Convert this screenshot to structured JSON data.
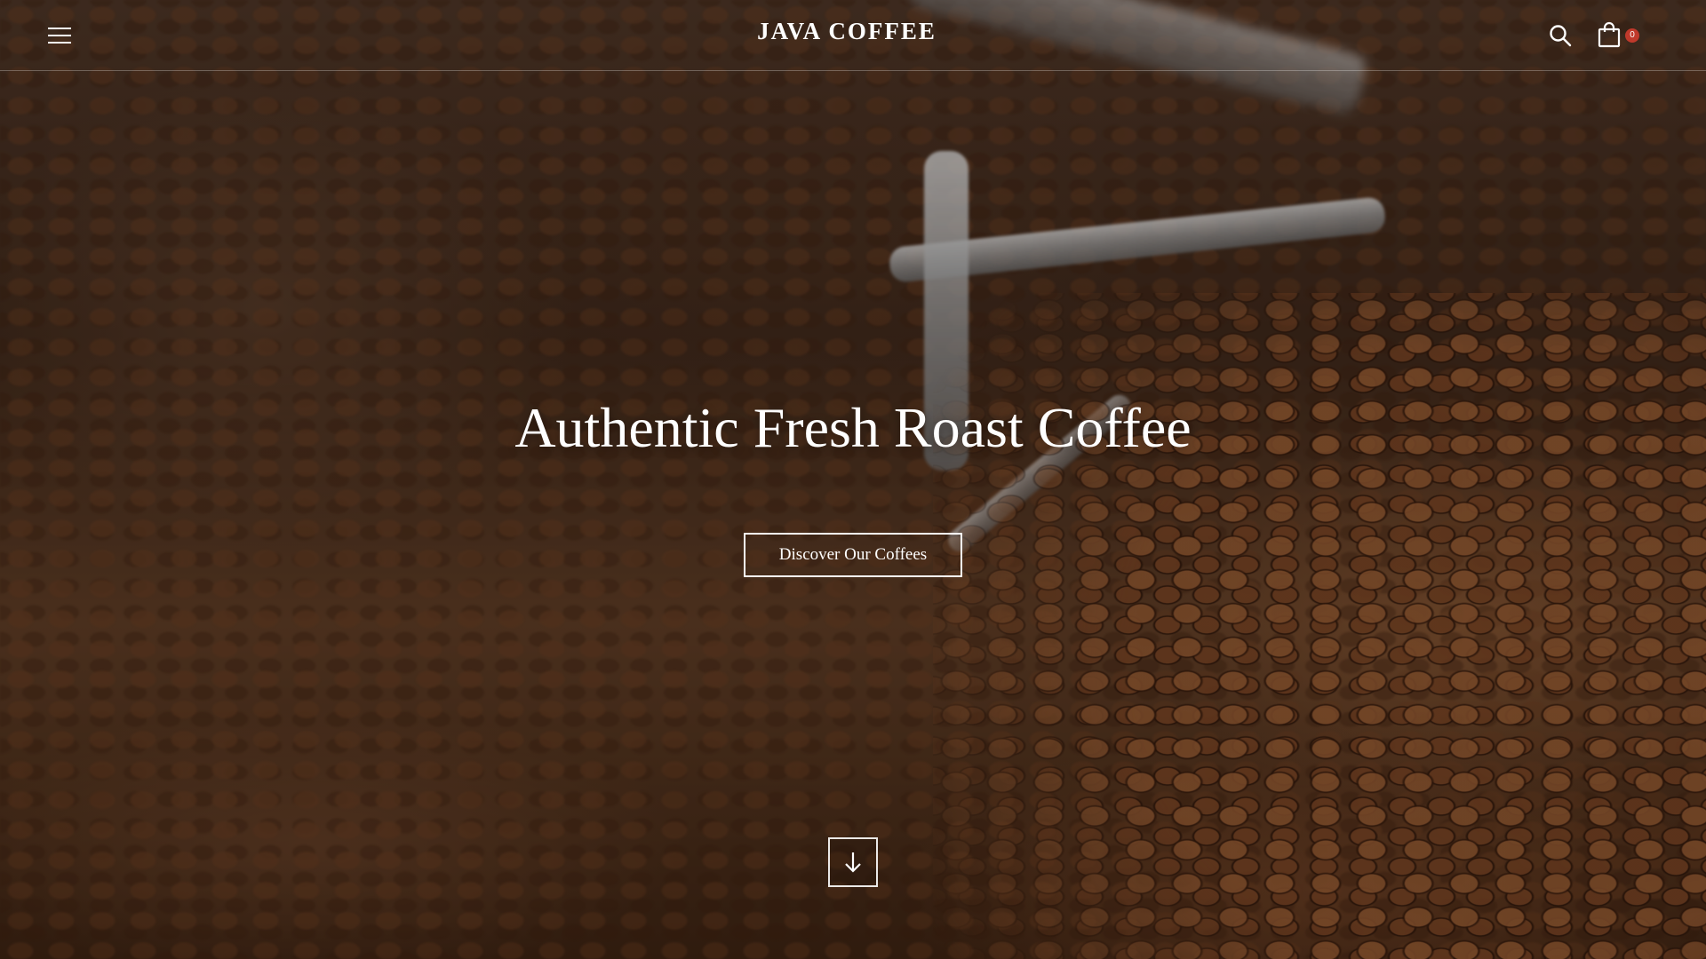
{
  "header": {
    "brand": "JAVA COFFEE",
    "cart_count": "0"
  },
  "icons": {
    "menu": "hamburger-menu-icon",
    "search": "search-icon",
    "cart": "shopping-bag-icon",
    "scroll": "arrow-down-icon"
  },
  "hero": {
    "title": "Authentic Fresh Roast Coffee",
    "cta_label": "Discover Our Coffees"
  },
  "colors": {
    "text": "#ffffff",
    "cart_badge": "#c0392b",
    "background": "#3b2619"
  }
}
